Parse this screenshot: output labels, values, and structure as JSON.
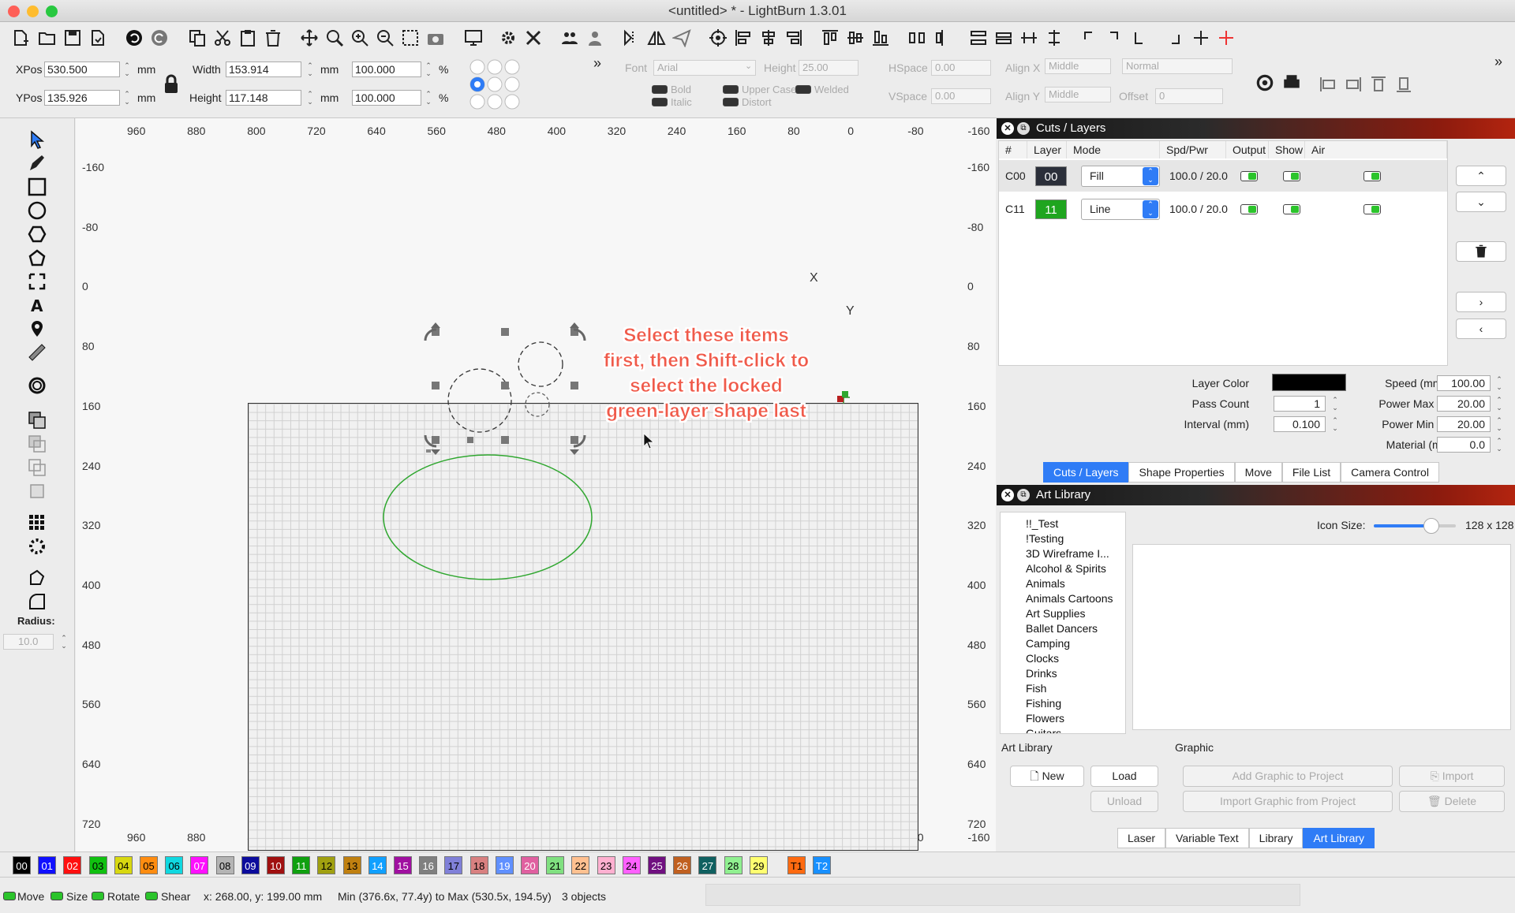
{
  "window": {
    "title": "<untitled> * - LightBurn 1.3.01"
  },
  "props": {
    "xpos_label": "XPos",
    "xpos": "530.500",
    "ypos_label": "YPos",
    "ypos": "135.926",
    "unit": "mm",
    "width_label": "Width",
    "width": "153.914",
    "height_label": "Height",
    "height": "117.148",
    "scale_w": "100.000",
    "scale_h": "100.000",
    "pct": "%",
    "font_label": "Font",
    "font": "Arial",
    "fheight_label": "Height",
    "fheight": "25.00",
    "hspace_label": "HSpace",
    "hspace": "0.00",
    "vspace_label": "VSpace",
    "vspace": "0.00",
    "alignx_label": "Align X",
    "alignx": "Middle",
    "aligny_label": "Align Y",
    "aligny": "Middle",
    "normal": "Normal",
    "offset_label": "Offset",
    "offset": "0",
    "bold": "Bold",
    "italic": "Italic",
    "upper": "Upper Case",
    "distort": "Distort",
    "welded": "Welded"
  },
  "tools": {
    "radius_label": "Radius:",
    "radius": "10.0"
  },
  "rulers": {
    "top": [
      "960",
      "880",
      "800",
      "720",
      "640",
      "560",
      "480",
      "400",
      "320",
      "240",
      "160",
      "80",
      "0",
      "-80",
      "-160"
    ],
    "left": [
      "-160",
      "-80",
      "0",
      "80",
      "160",
      "240",
      "320",
      "400",
      "480",
      "560",
      "640",
      "720"
    ]
  },
  "annotation": {
    "line1": "Select these items",
    "line2": "first, then Shift-click to",
    "line3": "select the locked",
    "line4": "green-layer shape last"
  },
  "axis": {
    "x": "X",
    "y": "Y"
  },
  "cuts_panel": {
    "title": "Cuts / Layers",
    "headers": [
      "#",
      "Layer",
      "Mode",
      "Spd/Pwr",
      "Output",
      "Show",
      "Air"
    ],
    "rows": [
      {
        "id": "C00",
        "layer": "00",
        "color": "#2b2f3a",
        "mode": "Fill",
        "spdpwr": "100.0 / 20.0"
      },
      {
        "id": "C11",
        "layer": "11",
        "color": "#1fa51f",
        "mode": "Line",
        "spdpwr": "100.0 / 20.0"
      }
    ],
    "layer_color_label": "Layer Color",
    "layer_color": "#000000",
    "pass_count_label": "Pass Count",
    "pass_count": "1",
    "interval_label": "Interval (mm)",
    "interval": "0.100",
    "speed_label": "Speed (mm/s)",
    "speed": "100.00",
    "pmax_label": "Power Max (%)",
    "pmax": "20.00",
    "pmin_label": "Power Min (%)",
    "pmin": "20.00",
    "material_label": "Material (mm)",
    "material": "0.0",
    "tabs": [
      "Cuts / Layers",
      "Shape Properties",
      "Move",
      "File List",
      "Camera Control"
    ]
  },
  "art_panel": {
    "title": "Art Library",
    "icon_size_label": "Icon Size:",
    "icon_size": "128 x 128",
    "icon_size_fraction": 0.7,
    "items": [
      "!!_Test",
      "!Testing",
      "3D Wireframe I...",
      "Alcohol & Spirits",
      "Animals",
      "Animals Cartoons",
      "Art Supplies",
      "Ballet Dancers",
      "Camping",
      "Clocks",
      "Drinks",
      "Fish",
      "Fishing",
      "Flowers",
      "Guitars"
    ],
    "art_library_label": "Art Library",
    "graphic_label": "Graphic",
    "new": "New",
    "load": "Load",
    "unload": "Unload",
    "add_graphic": "Add Graphic to Project",
    "import_graphic": "Import Graphic from Project",
    "import": "Import",
    "delete": "Delete",
    "tabs": [
      "Laser",
      "Variable Text",
      "Library",
      "Art Library"
    ]
  },
  "palette": [
    {
      "l": "00",
      "c": "#000000",
      "t": "#fff"
    },
    {
      "l": "01",
      "c": "#1010ff",
      "t": "#fff"
    },
    {
      "l": "02",
      "c": "#ff1010",
      "t": "#fff"
    },
    {
      "l": "03",
      "c": "#10c010",
      "t": "#000"
    },
    {
      "l": "04",
      "c": "#d8d810",
      "t": "#000"
    },
    {
      "l": "05",
      "c": "#ff8c10",
      "t": "#000"
    },
    {
      "l": "06",
      "c": "#10d8e0",
      "t": "#000"
    },
    {
      "l": "07",
      "c": "#ff10ff",
      "t": "#fff"
    },
    {
      "l": "08",
      "c": "#b4b4b4",
      "t": "#000"
    },
    {
      "l": "09",
      "c": "#0c0c9c",
      "t": "#fff"
    },
    {
      "l": "10",
      "c": "#a01010",
      "t": "#fff"
    },
    {
      "l": "11",
      "c": "#10a010",
      "t": "#fff"
    },
    {
      "l": "12",
      "c": "#a0a010",
      "t": "#000"
    },
    {
      "l": "13",
      "c": "#c08010",
      "t": "#000"
    },
    {
      "l": "14",
      "c": "#10a0ff",
      "t": "#fff"
    },
    {
      "l": "15",
      "c": "#a010a0",
      "t": "#fff"
    },
    {
      "l": "16",
      "c": "#808080",
      "t": "#fff"
    },
    {
      "l": "17",
      "c": "#8080d8",
      "t": "#000"
    },
    {
      "l": "18",
      "c": "#d88080",
      "t": "#000"
    },
    {
      "l": "19",
      "c": "#6090ff",
      "t": "#fff"
    },
    {
      "l": "20",
      "c": "#e060a0",
      "t": "#fff"
    },
    {
      "l": "21",
      "c": "#80e080",
      "t": "#000"
    },
    {
      "l": "22",
      "c": "#ffc090",
      "t": "#000"
    },
    {
      "l": "23",
      "c": "#ffb0d0",
      "t": "#000"
    },
    {
      "l": "24",
      "c": "#ff60ff",
      "t": "#000"
    },
    {
      "l": "25",
      "c": "#701080",
      "t": "#fff"
    },
    {
      "l": "26",
      "c": "#c06020",
      "t": "#fff"
    },
    {
      "l": "27",
      "c": "#106060",
      "t": "#fff"
    },
    {
      "l": "28",
      "c": "#90f090",
      "t": "#000"
    },
    {
      "l": "29",
      "c": "#ffff70",
      "t": "#000"
    },
    {
      "l": "T1",
      "c": "#ff6a10",
      "t": "#000"
    },
    {
      "l": "T2",
      "c": "#1890ff",
      "t": "#fff"
    }
  ],
  "status": {
    "move": "Move",
    "size": "Size",
    "rotate": "Rotate",
    "shear": "Shear",
    "coords": "x: 268.00, y: 199.00 mm",
    "bounds": "Min (376.6x, 77.4y) to Max (530.5x, 194.5y)",
    "count": "3 objects"
  }
}
